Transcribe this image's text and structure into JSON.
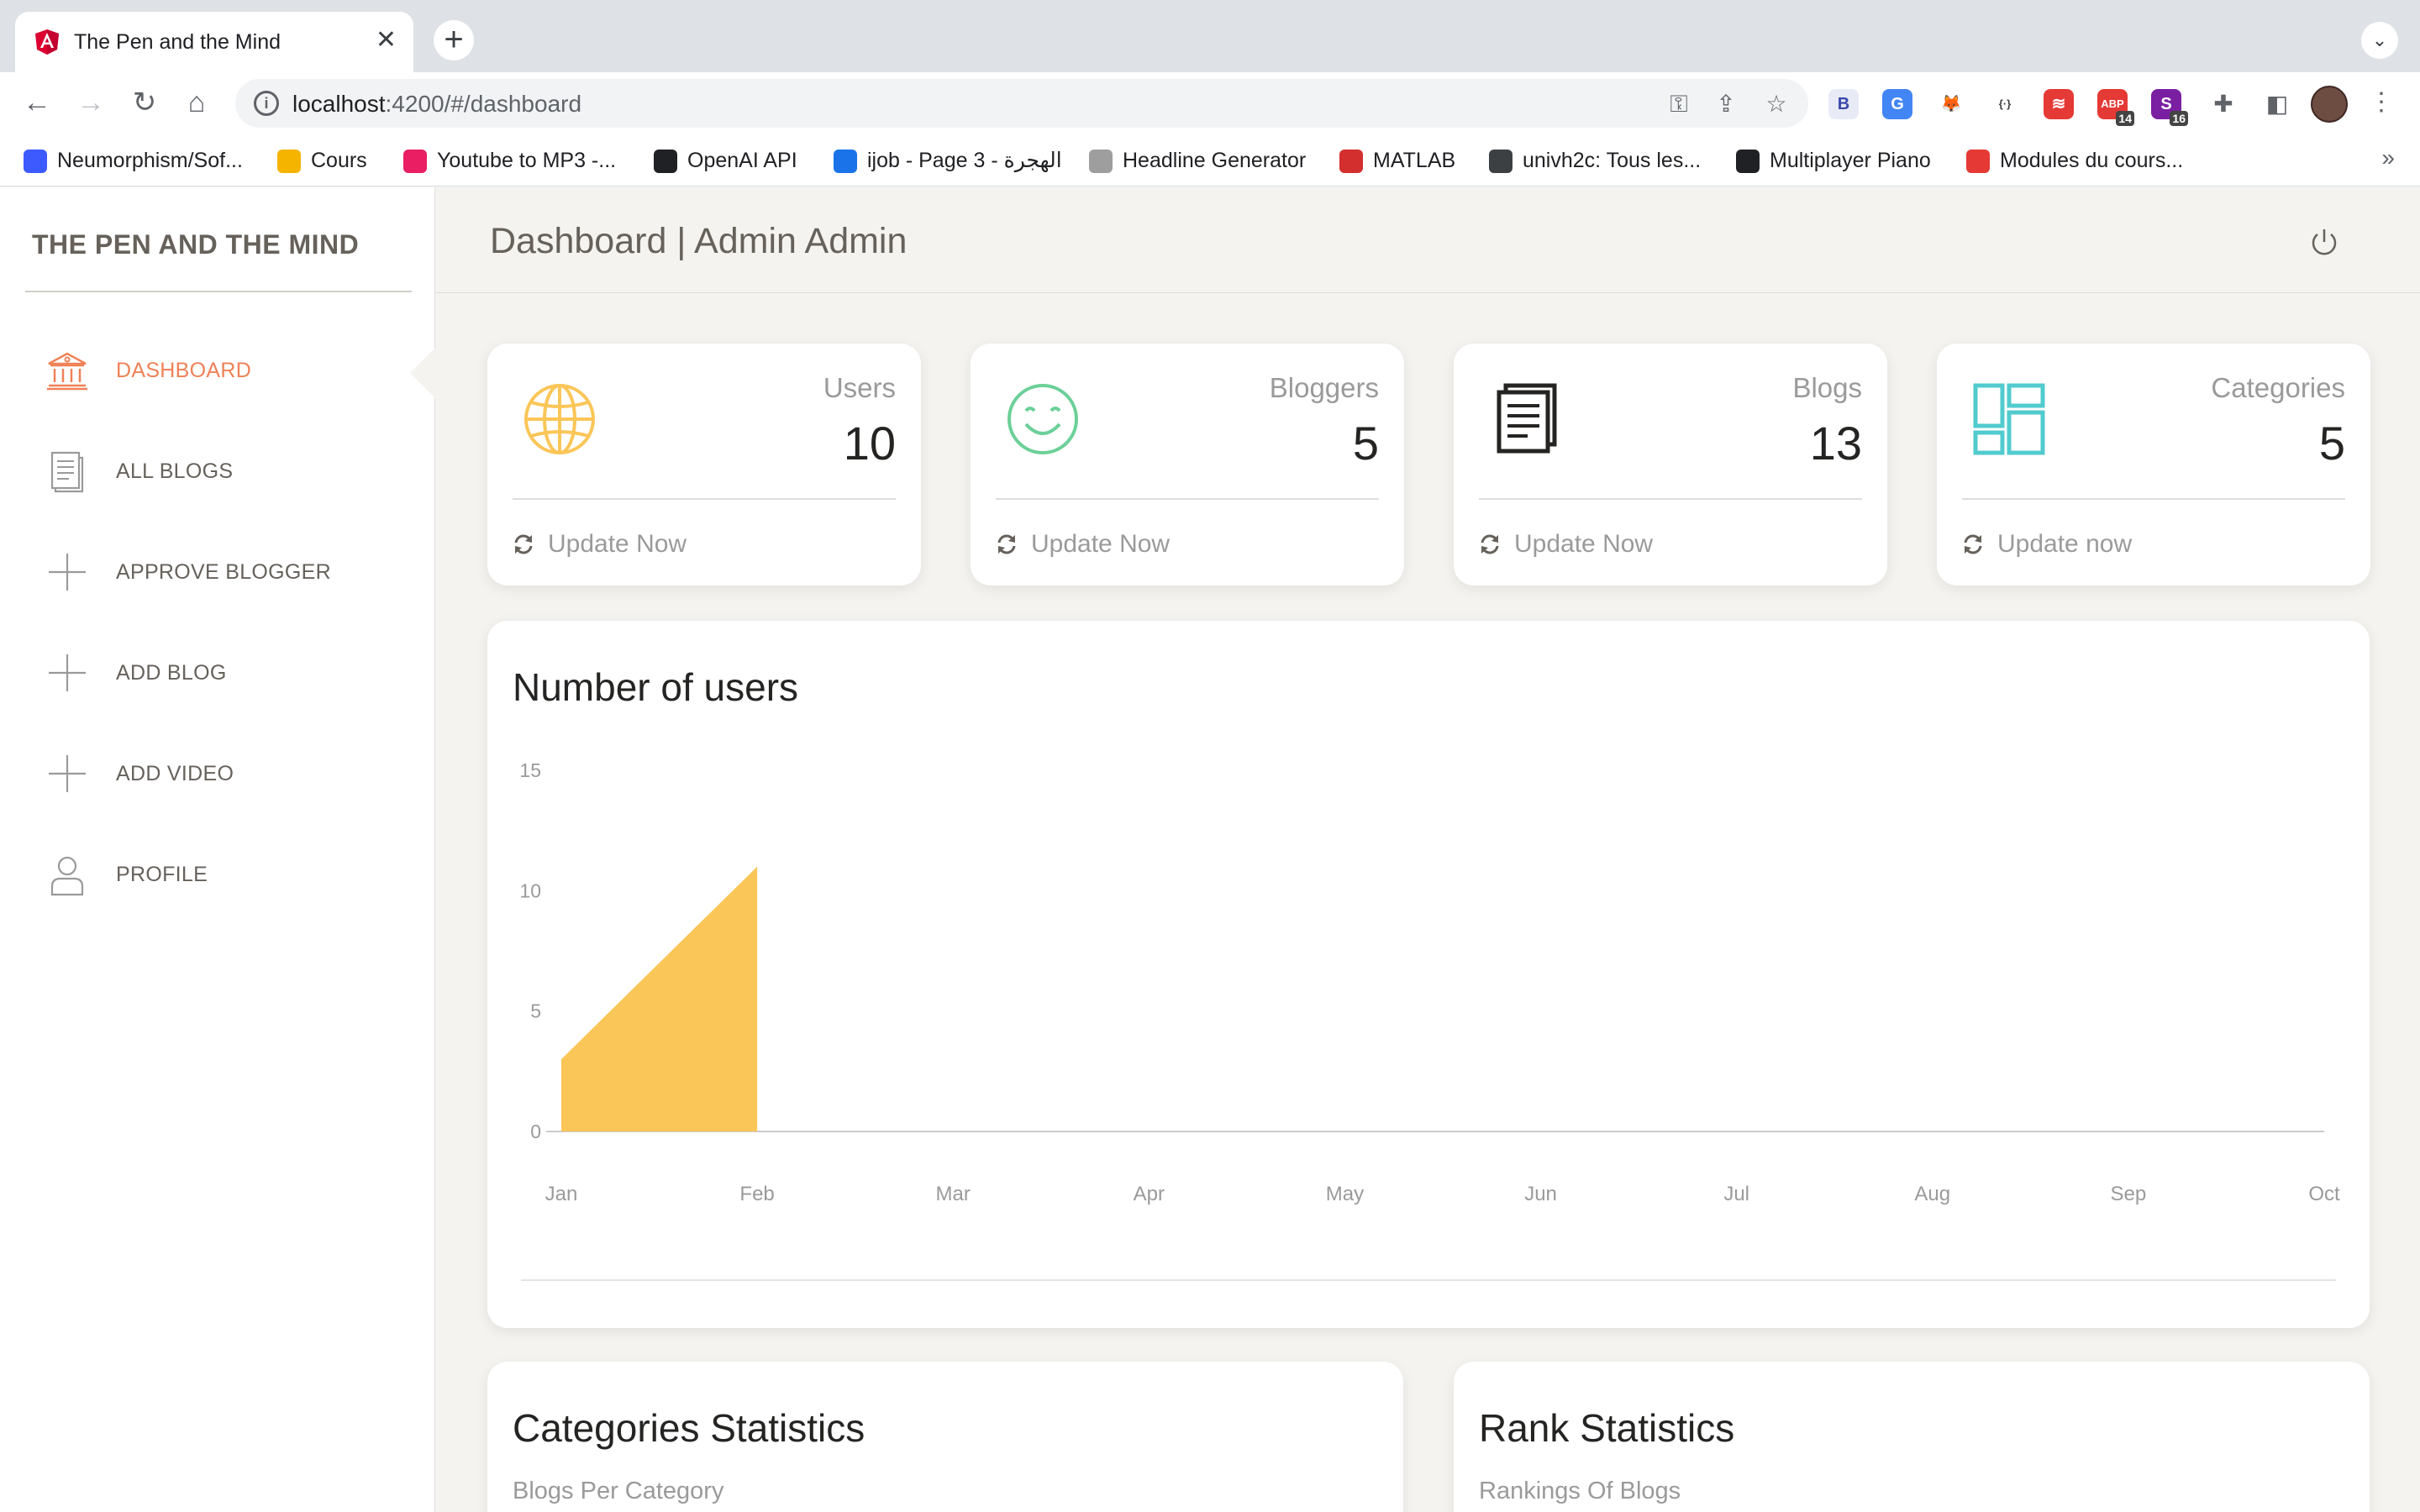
{
  "browser": {
    "tab_title": "The Pen and the Mind",
    "url_host": "localhost",
    "url_rest": ":4200/#/dashboard",
    "bookmarks": [
      {
        "label": "Neumorphism/Sof...",
        "icon": "square-blue-icon",
        "color": "#3d5afe"
      },
      {
        "label": "Cours",
        "icon": "classroom-icon",
        "color": "#f4b400"
      },
      {
        "label": "Youtube to MP3 -...",
        "icon": "download-icon",
        "color": "#e91e63"
      },
      {
        "label": "OpenAI API",
        "icon": "openai-icon",
        "color": "#202124"
      },
      {
        "label": "ijob - Page 3 - الهجرة",
        "icon": "ijob-icon",
        "color": "#1a73e8"
      },
      {
        "label": "Headline Generator",
        "icon": "lightbulb-icon",
        "color": "#9e9e9e"
      },
      {
        "label": "MATLAB",
        "icon": "matlab-icon",
        "color": "#d32f2f"
      },
      {
        "label": "univh2c: Tous les...",
        "icon": "globe-icon",
        "color": "#3c4043"
      },
      {
        "label": "Multiplayer Piano",
        "icon": "piano-icon",
        "color": "#202124"
      },
      {
        "label": "Modules du cours...",
        "icon": "snowflake-icon",
        "color": "#e53935"
      }
    ],
    "extensions": [
      {
        "name": "b-extension-icon",
        "text": "B",
        "color": "#e8eaf6",
        "fg": "#3949ab"
      },
      {
        "name": "translate-icon",
        "text": "G",
        "color": "#4285f4",
        "fg": "#ffffff"
      },
      {
        "name": "metamask-icon",
        "text": "🦊",
        "color": "#ffffff",
        "fg": "#e2761b"
      },
      {
        "name": "code-icon",
        "text": "{·}",
        "color": "#ffffff",
        "fg": "#3c4043"
      },
      {
        "name": "stack-icon",
        "text": "≋",
        "color": "#e53935",
        "fg": "#ffffff"
      },
      {
        "name": "adblock-icon",
        "text": "ABP",
        "color": "#e53935",
        "fg": "#ffffff",
        "badge": "14"
      },
      {
        "name": "s-extension-icon",
        "text": "S",
        "color": "#7b1fa2",
        "fg": "#ffffff",
        "badge": "16"
      }
    ]
  },
  "sidebar": {
    "brand": "THE PEN AND THE MIND",
    "items": [
      {
        "label": "DASHBOARD",
        "icon": "bank-icon",
        "active": true
      },
      {
        "label": "ALL BLOGS",
        "icon": "document-icon"
      },
      {
        "label": "APPROVE BLOGGER",
        "icon": "plus-icon"
      },
      {
        "label": "ADD BLOG",
        "icon": "plus-icon"
      },
      {
        "label": "ADD VIDEO",
        "icon": "plus-icon"
      },
      {
        "label": "PROFILE",
        "icon": "user-icon"
      }
    ]
  },
  "header": {
    "title": "Dashboard | Admin Admin"
  },
  "stats": [
    {
      "label": "Users",
      "value": "10",
      "footer": "Update Now",
      "icon": "globe-icon",
      "color": "#fbc658"
    },
    {
      "label": "Bloggers",
      "value": "5",
      "footer": "Update Now",
      "icon": "smile-icon",
      "color": "#6bd098"
    },
    {
      "label": "Blogs",
      "value": "13",
      "footer": "Update Now",
      "icon": "paper-icon",
      "color": "#252422"
    },
    {
      "label": "Categories",
      "value": "5",
      "footer": "Update now",
      "icon": "layout-icon",
      "color": "#51cbce"
    }
  ],
  "chart_data": {
    "type": "area",
    "title": "Number of users",
    "categories": [
      "Jan",
      "Feb",
      "Mar",
      "Apr",
      "May",
      "Jun",
      "Jul",
      "Aug",
      "Sep",
      "Oct"
    ],
    "series": [
      {
        "values": [
          3,
          11,
          null,
          null,
          null,
          null,
          null,
          null,
          null,
          null
        ],
        "color": "#fbc658"
      }
    ],
    "ylim": [
      0,
      15
    ],
    "yticks": [
      0,
      5,
      10,
      15
    ],
    "grid": false
  },
  "lower": {
    "categories_title": "Categories Statistics",
    "categories_sub": "Blogs Per Category",
    "rank_title": "Rank Statistics",
    "rank_sub": "Rankings Of Blogs"
  }
}
